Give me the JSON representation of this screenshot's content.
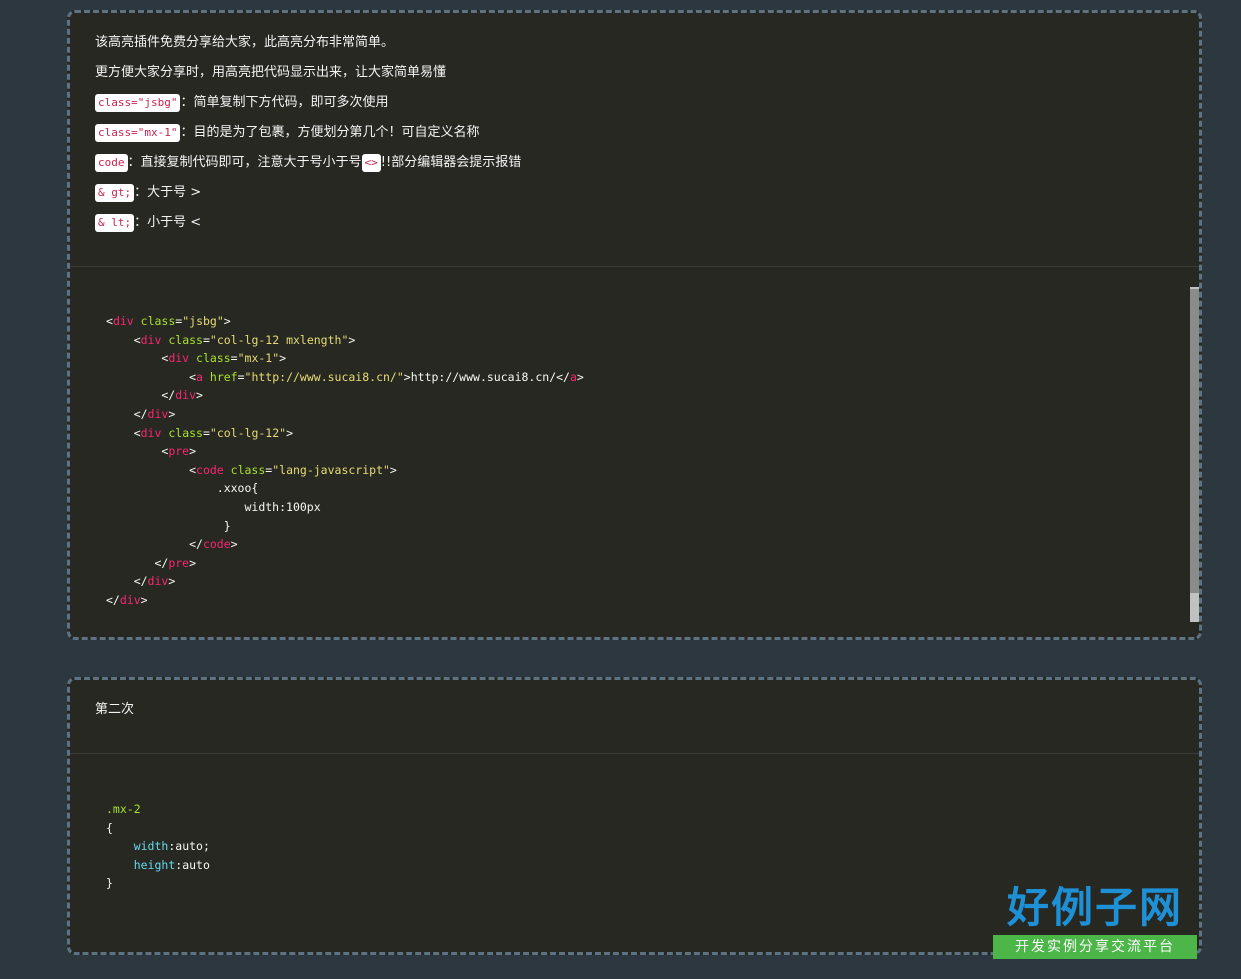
{
  "card1": {
    "lines": [
      {
        "text": "该高亮插件免费分享给大家，此高亮分布非常简单。"
      },
      {
        "text": "更方便大家分享时，用高亮把代码显示出来，让大家简单易懂"
      },
      {
        "tag": "class=\"jsbg\"",
        "text": "：简单复制下方代码，即可多次使用"
      },
      {
        "tag": "class=\"mx-1\"",
        "text": "：目的是为了包裹，方便划分第几个！可自定义名称"
      },
      {
        "tag": "code",
        "text": "：直接复制代码即可，注意大于号小于号",
        "tag2": "<>",
        "text2": "!!部分编辑器会提示报错"
      },
      {
        "tag": "& gt;",
        "text": "：大于号 >"
      },
      {
        "tag": "& lt; ",
        "text": "：小于号 <"
      }
    ],
    "code": {
      "l1_tag": "div",
      "l1_attr": "class",
      "l1_val": "\"jsbg\"",
      "l2_tag": "div",
      "l2_attr": "class",
      "l2_val": "\"col-lg-12 mxlength\"",
      "l3_tag": "div",
      "l3_attr": "class",
      "l3_val": "\"mx-1\"",
      "l4_tag": "a",
      "l4_attr": "href",
      "l4_val": "\"http://www.sucai8.cn/\"",
      "l4_text": "http://www.sucai8.cn/",
      "l4_close": "a",
      "l5_close": "div",
      "l6_close": "div",
      "l7_tag": "div",
      "l7_attr": "class",
      "l7_val": "\"col-lg-12\"",
      "l8_tag": "pre",
      "l9_tag": "code",
      "l9_attr": "class",
      "l9_val": "\"lang-javascript\"",
      "l10_text": ".xxoo{",
      "l11_text": "width:100px",
      "l12_text": "}",
      "l13_close": "code",
      "l14_close": "pre",
      "l15_close": "div",
      "l16_close": "div"
    }
  },
  "card2": {
    "title": "第二次",
    "code": {
      "selector": ".mx-2",
      "open": "{",
      "prop1": "width",
      "val1": "auto;",
      "prop2": "height",
      "val2": "auto",
      "close": "}"
    }
  },
  "watermark": {
    "title": "好例子网",
    "subtitle": "开发实例分享交流平台"
  }
}
